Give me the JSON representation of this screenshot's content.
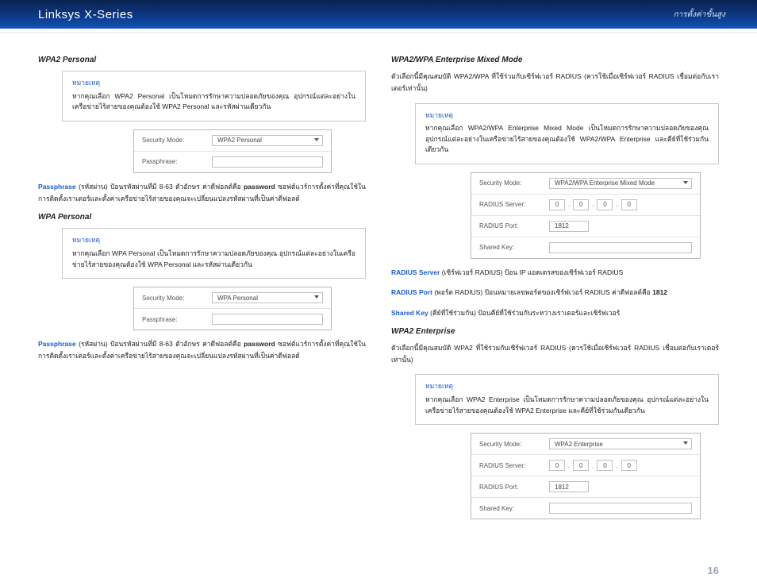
{
  "header": {
    "title": "Linksys X-Series",
    "subtitle": "การตั้งค่าขั้นสูง"
  },
  "pageNumber": "16",
  "labels": {
    "noteLabel": "หมายเหตุ",
    "securityMode": "Security Mode:",
    "passphrase": "Passphrase:",
    "radiusServer": "RADIUS Server:",
    "radiusPort": "RADIUS Port:",
    "sharedKey": "Shared Key:"
  },
  "left": {
    "wpa2personal": {
      "heading": "WPA2 Personal",
      "note": "หากคุณเลือก WPA2 Personal เป็นโหมดการรักษาความปลอดภัยของคุณ อุปกรณ์แต่ละอย่างในเครือข่ายไร้สายของคุณต้องใช้ WPA2 Personal และรหัสผ่านเดียวกัน",
      "mode": "WPA2 Personal",
      "passpara": "(รหัสผ่าน) ป้อนรหัสผ่านที่มี 8-63 ตัวอักษร ค่าดีฟอลต์คือ",
      "passdefault": "password",
      "passpara2": "ซอฟต์แวร์การตั้งค่าที่คุณใช้ในการติดตั้งเราเตอร์และตั้งค่าเครือข่ายไร้สายของคุณจะเปลี่ยนแปลงรหัสผ่านที่เป็นค่าดีฟอลต์"
    },
    "wpapersonal": {
      "heading": "WPA Personal",
      "note": "หากคุณเลือก WPA Personal เป็นโหมดการรักษาความปลอดภัยของคุณ อุปกรณ์แต่ละอย่างในเครือข่ายไร้สายของคุณต้องใช้ WPA Personal และรหัสผ่านเดียวกัน",
      "mode": "WPA Personal",
      "passpara": "(รหัสผ่าน) ป้อนรหัสผ่านที่มี 8-63 ตัวอักษร ค่าดีฟอลต์คือ",
      "passdefault": "password",
      "passpara2": "ซอฟต์แวร์การตั้งค่าที่คุณใช้ในการติดตั้งเราเตอร์และตั้งค่าเครือข่ายไร้สายของคุณจะเปลี่ยนแปลงรหัสผ่านที่เป็นค่าดีฟอลต์"
    }
  },
  "right": {
    "mixed": {
      "heading": "WPA2/WPA Enterprise Mixed Mode",
      "intro": "ตัวเลือกนี้มีคุณสมบัติ WPA2/WPA ที่ใช้ร่วมกับเซิร์ฟเวอร์ RADIUS (ควรใช้เมื่อเซิร์ฟเวอร์ RADIUS เชื่อมต่อกับเราเตอร์เท่านั้น)",
      "note": "หากคุณเลือก WPA2/WPA Enterprise Mixed Mode เป็นโหมดการรักษาความปลอดภัยของคุณ อุปกรณ์แต่ละอย่างในเครือข่ายไร้สายของคุณต้องใช้ WPA2/WPA Enterprise และคีย์ที่ใช้ร่วมกันเดียวกัน",
      "mode": "WPA2/WPA Enterprise Mixed Mode",
      "ip": [
        "0",
        "0",
        "0",
        "0"
      ],
      "port": "1812",
      "radiusServerTerm": "RADIUS Server",
      "radiusServerDesc": "(เซิร์ฟเวอร์ RADIUS) ป้อน IP แอดเดรสของเซิร์ฟเวอร์ RADIUS",
      "radiusPortTerm": "RADIUS Port",
      "radiusPortDesc": "(พอร์ต RADIUS) ป้อนหมายเลขพอร์ตของเซิร์ฟเวอร์ RADIUS ค่าดีฟอลต์คือ",
      "radiusPortDefault": "1812",
      "sharedKeyTerm": "Shared Key",
      "sharedKeyDesc": "(คีย์ที่ใช้ร่วมกัน) ป้อนคีย์ที่ใช้ร่วมกันระหว่างเราเตอร์และเซิร์ฟเวอร์"
    },
    "wpa2ent": {
      "heading": "WPA2 Enterprise",
      "intro": "ตัวเลือกนี้มีคุณสมบัติ WPA2 ที่ใช้ร่วมกับเซิร์ฟเวอร์ RADIUS (ควรใช้เมื่อเซิร์ฟเวอร์ RADIUS เชื่อมต่อกับเราเตอร์เท่านั้น)",
      "note": "หากคุณเลือก WPA2 Enterprise เป็นโหมดการรักษาความปลอดภัยของคุณ อุปกรณ์แต่ละอย่างในเครือข่ายไร้สายของคุณต้องใช้ WPA2 Enterprise และคีย์ที่ใช้ร่วมกันเดียวกัน",
      "mode": "WPA2 Enterprise",
      "ip": [
        "0",
        "0",
        "0",
        "0"
      ],
      "port": "1812"
    }
  },
  "terms": {
    "passphrase": "Passphrase"
  }
}
